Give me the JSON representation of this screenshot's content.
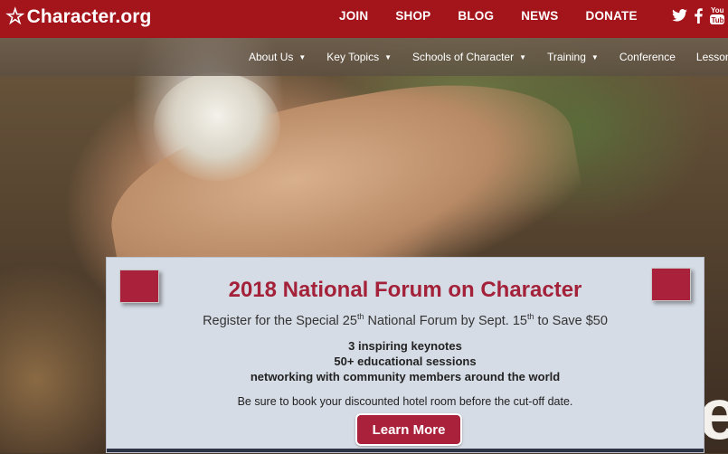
{
  "brand": {
    "logo_text": "Character.org",
    "logo_icon": "star-icon"
  },
  "topnav": {
    "items": [
      "JOIN",
      "SHOP",
      "BLOG",
      "NEWS",
      "DONATE"
    ]
  },
  "social": {
    "icons": [
      "twitter-icon",
      "facebook-icon",
      "youtube-icon"
    ]
  },
  "subnav": {
    "items": [
      {
        "label": "About Us",
        "dropdown": true
      },
      {
        "label": "Key Topics",
        "dropdown": true
      },
      {
        "label": "Schools of Character",
        "dropdown": true
      },
      {
        "label": "Training",
        "dropdown": true
      },
      {
        "label": "Conference",
        "dropdown": false
      },
      {
        "label": "Lesson",
        "dropdown": false
      }
    ]
  },
  "promo": {
    "title": "2018 National Forum on Character",
    "subtitle_part1": "Register for the Special 25",
    "subtitle_sup1": "th",
    "subtitle_part2": " National Forum by Sept. 15",
    "subtitle_sup2": "th",
    "subtitle_part3": " to Save $50",
    "bullets": [
      "3 inspiring keynotes",
      "50+ educational sessions",
      "networking with community members around the world"
    ],
    "note": "Be sure to book your discounted hotel room before the cut-off date.",
    "button_label": "Learn More"
  },
  "hero": {
    "visible_letter": "e"
  },
  "colors": {
    "brand_red": "#a4141b",
    "accent_red": "#a9213a",
    "promo_bg": "#d6dce5"
  }
}
